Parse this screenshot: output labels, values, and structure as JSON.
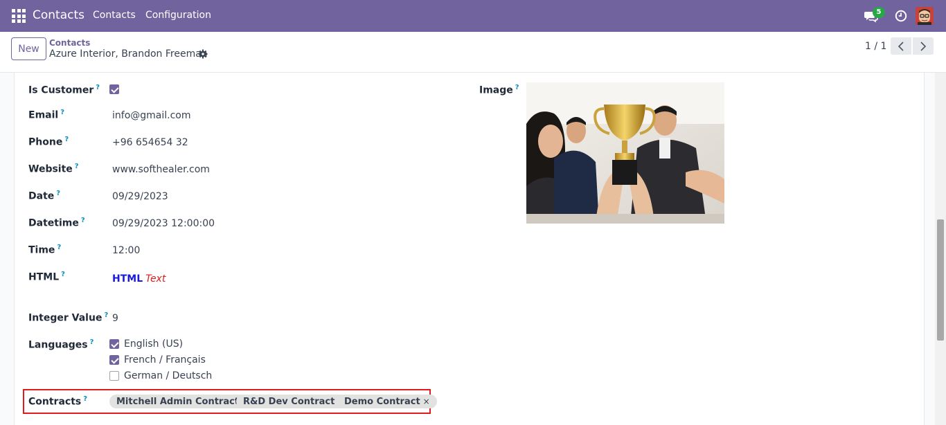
{
  "navbar": {
    "brand": "Contacts",
    "menu": [
      "Contacts",
      "Configuration"
    ],
    "chat_badge": "5",
    "accent_color": "#71639e"
  },
  "control_panel": {
    "new_label": "New",
    "breadcrumb_parent": "Contacts",
    "breadcrumb_current": "Azure Interior, Brandon Freeman",
    "pager_value": "1 / 1"
  },
  "form": {
    "help_mark": "?",
    "is_customer": {
      "label": "Is Customer",
      "checked": true
    },
    "email": {
      "label": "Email",
      "value": "info@gmail.com"
    },
    "phone": {
      "label": "Phone",
      "value": "+96 654654 32"
    },
    "website": {
      "label": "Website",
      "value": "www.softhealer.com"
    },
    "date": {
      "label": "Date",
      "value": "09/29/2023"
    },
    "datetime": {
      "label": "Datetime",
      "value": "09/29/2023 12:00:00"
    },
    "time": {
      "label": "Time",
      "value": "12:00"
    },
    "html": {
      "label": "HTML",
      "bold_text": "HTML",
      "italic_text": "Text"
    },
    "integer_value": {
      "label": "Integer Value",
      "value": "9"
    },
    "languages": {
      "label": "Languages",
      "options": [
        {
          "label": "English (US)",
          "checked": true
        },
        {
          "label": "French / Français",
          "checked": true
        },
        {
          "label": "German / Deutsch",
          "checked": false
        }
      ]
    },
    "contracts": {
      "label": "Contracts",
      "tags": [
        "Mitchell Admin Contract",
        "R&D Dev Contract",
        "Demo Contract"
      ],
      "remove_mark": "×"
    },
    "image": {
      "label": "Image"
    }
  }
}
